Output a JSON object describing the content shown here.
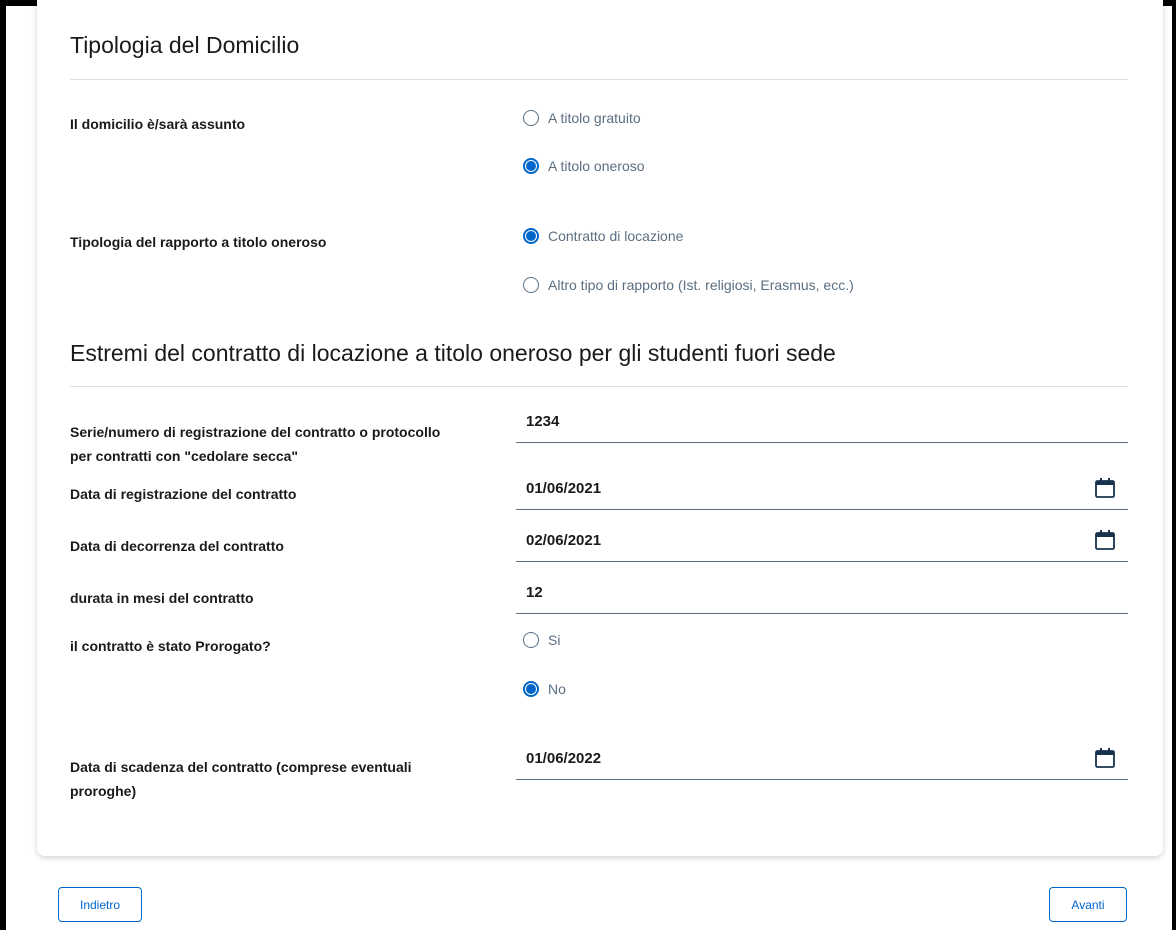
{
  "section1": {
    "title": "Tipologia del Domicilio",
    "domicilio": {
      "label": "Il domicilio è/sarà assunto",
      "options": [
        {
          "label": "A titolo gratuito",
          "checked": false
        },
        {
          "label": "A titolo oneroso",
          "checked": true
        }
      ]
    },
    "rapporto": {
      "label": "Tipologia del rapporto a titolo oneroso",
      "options": [
        {
          "label": "Contratto di locazione",
          "checked": true
        },
        {
          "label": "Altro tipo di rapporto (Ist. religiosi, Erasmus, ecc.)",
          "checked": false
        }
      ]
    }
  },
  "section2": {
    "title": "Estremi del contratto di locazione a titolo oneroso per gli studenti fuori sede",
    "fields": {
      "serie": {
        "label_line1": "Serie/numero di registrazione del contratto o protocollo",
        "label_line2": "per contratti con \"cedolare secca\"",
        "value": "1234"
      },
      "data_registrazione": {
        "label": "Data di registrazione del contratto",
        "value": "01/06/2021"
      },
      "data_decorrenza": {
        "label": "Data di decorrenza del contratto",
        "value": "02/06/2021"
      },
      "durata": {
        "label": "durata in mesi del contratto",
        "value": "12"
      },
      "prorogato": {
        "label": "il contratto è stato Prorogato?",
        "options": [
          {
            "label": "Si",
            "checked": false
          },
          {
            "label": "No",
            "checked": true
          }
        ]
      },
      "data_scadenza": {
        "label_line1": "Data di scadenza del contratto (comprese eventuali",
        "label_line2": "proroghe)",
        "value": "01/06/2022"
      }
    }
  },
  "footer": {
    "back_label": "Indietro",
    "next_label": "Avanti"
  },
  "icons": {
    "calendar": "calendar-icon"
  },
  "colors": {
    "accent": "#0066cc",
    "text": "#1a1a1a",
    "muted": "#5c6f82"
  }
}
